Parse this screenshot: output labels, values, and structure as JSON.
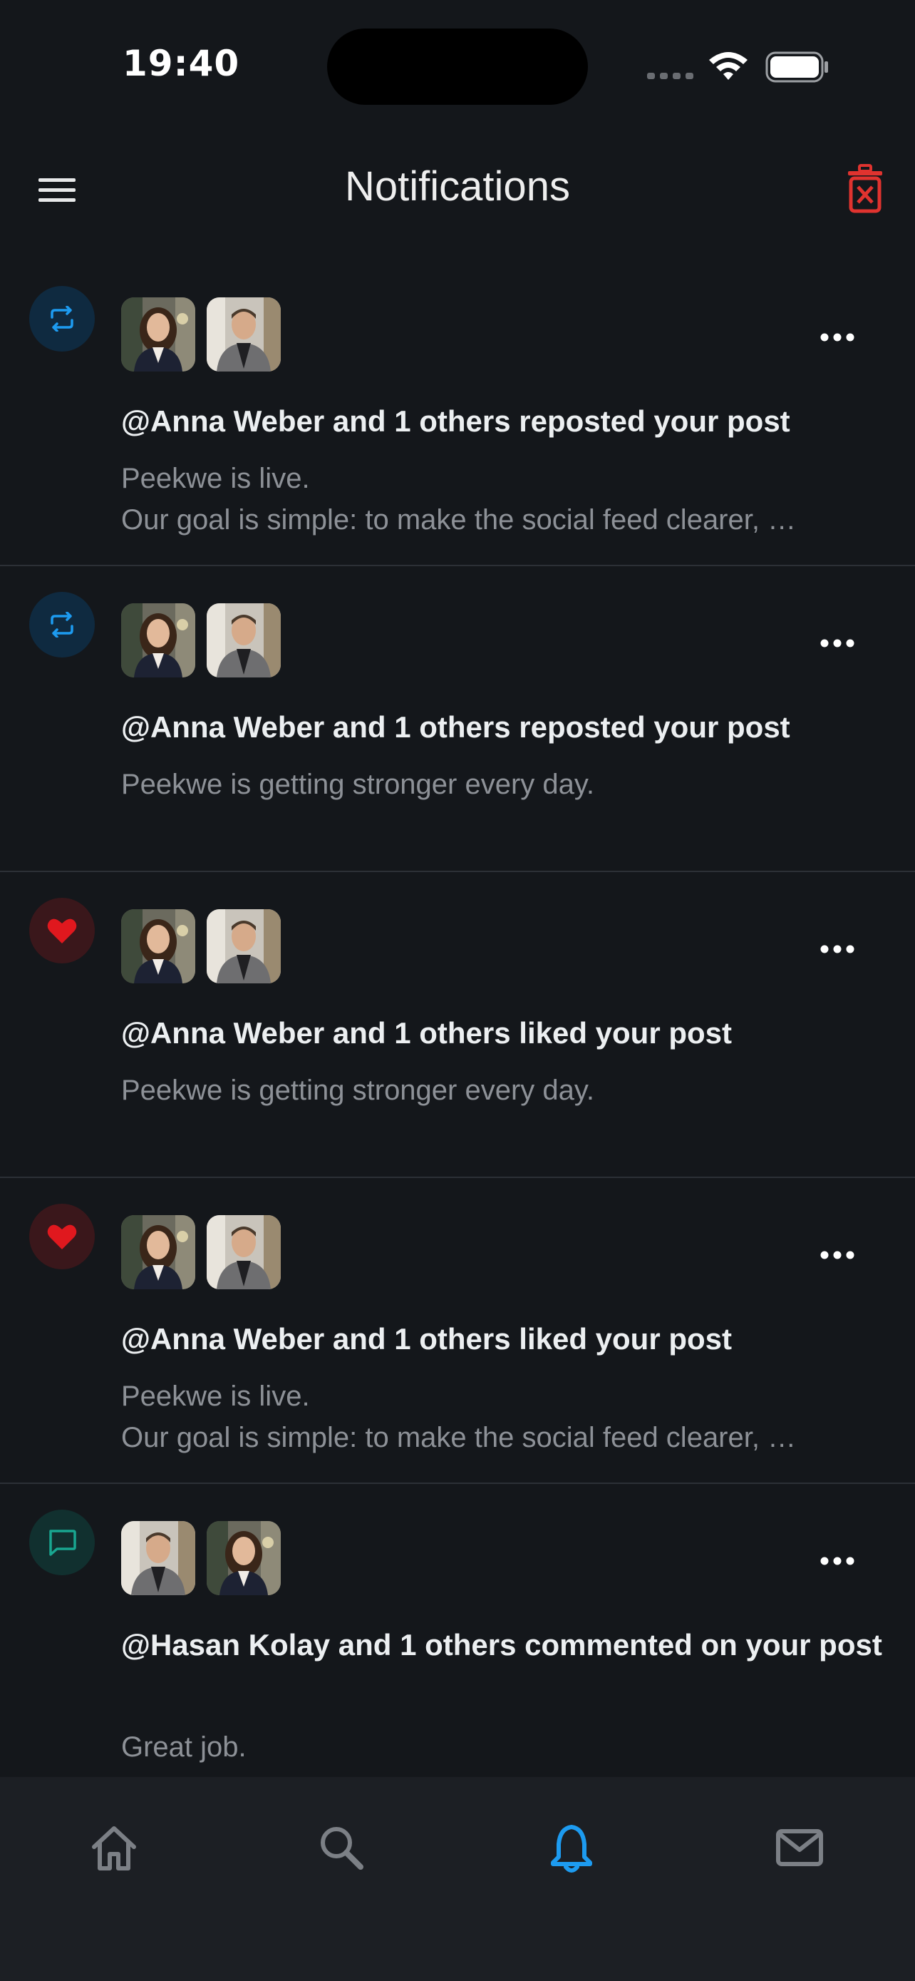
{
  "status_bar": {
    "time": "19:40"
  },
  "header": {
    "title": "Notifications",
    "menu_icon": "hamburger-menu-icon",
    "delete_icon": "trash-delete-icon"
  },
  "colors": {
    "background": "#14171b",
    "repost": "#1d9bf0",
    "like": "#e0181e",
    "comment": "#19a690",
    "delete": "#e0332f"
  },
  "notifications": [
    {
      "type": "repost",
      "icon": "repost-icon",
      "avatars": [
        "woman-avatar",
        "man-avatar"
      ],
      "headline": "@Anna Weber and 1 others reposted your post",
      "preview": [
        "Peekwe is live.",
        "Our goal is simple: to make the social feed clearer, …"
      ]
    },
    {
      "type": "repost",
      "icon": "repost-icon",
      "avatars": [
        "woman-avatar",
        "man-avatar"
      ],
      "headline": "@Anna Weber and 1 others reposted your post",
      "preview": [
        "Peekwe is getting stronger every day."
      ]
    },
    {
      "type": "like",
      "icon": "heart-icon",
      "avatars": [
        "woman-avatar",
        "man-avatar"
      ],
      "headline": "@Anna Weber and 1 others liked your post",
      "preview": [
        "Peekwe is getting stronger every day."
      ]
    },
    {
      "type": "like",
      "icon": "heart-icon",
      "avatars": [
        "woman-avatar",
        "man-avatar"
      ],
      "headline": "@Anna Weber and 1 others liked your post",
      "preview": [
        "Peekwe is live.",
        "Our goal is simple: to make the social feed clearer, …"
      ]
    },
    {
      "type": "comment",
      "icon": "comment-icon",
      "avatars": [
        "man-avatar",
        "woman-avatar"
      ],
      "headline": "@Hasan Kolay and 1 others commented on your post",
      "preview": [
        "Great job."
      ]
    }
  ],
  "tabbar": [
    {
      "icon": "home-icon",
      "active": false
    },
    {
      "icon": "search-icon",
      "active": false
    },
    {
      "icon": "bell-icon",
      "active": true
    },
    {
      "icon": "mail-icon",
      "active": false
    }
  ]
}
